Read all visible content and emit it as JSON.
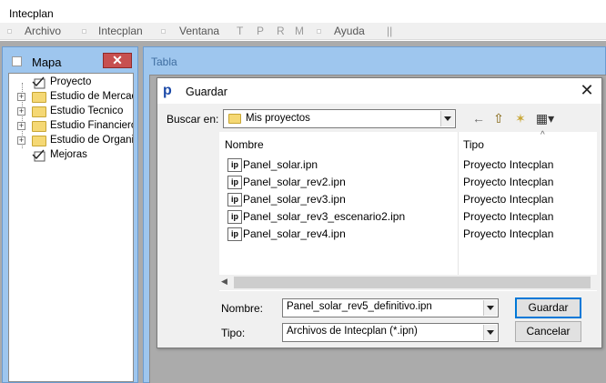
{
  "app": {
    "title": "Intecplan"
  },
  "menu": {
    "items": [
      "Archivo",
      "Intecplan",
      "Ventana",
      "T",
      "P",
      "R",
      "M",
      "Ayuda",
      "||"
    ]
  },
  "mapa": {
    "title": "Mapa",
    "close_glyph": "✕",
    "tree": [
      {
        "label": "Proyecto",
        "kind": "doc",
        "expandable": false
      },
      {
        "label": "Estudio de Mercado",
        "kind": "folder",
        "expandable": true
      },
      {
        "label": "Estudio Tecnico",
        "kind": "folder",
        "expandable": true
      },
      {
        "label": "Estudio Financiero",
        "kind": "folder",
        "expandable": true
      },
      {
        "label": "Estudio de Organizacion",
        "kind": "folder",
        "expandable": true
      },
      {
        "label": "Mejoras",
        "kind": "doc",
        "expandable": false
      }
    ]
  },
  "tabla": {
    "title": "Tabla"
  },
  "dialog": {
    "title": "Guardar",
    "icon_letter": "p",
    "close_glyph": "✕",
    "lookin_label": "Buscar en:",
    "lookin_value": "Mis proyectos",
    "toolbar": {
      "back": "←",
      "up": "⇧",
      "new_folder": "✶",
      "view": "▦▾"
    },
    "columns": {
      "name": "Nombre",
      "type": "Tipo"
    },
    "files": [
      {
        "name": "Panel_solar.ipn",
        "type": "Proyecto Intecplan"
      },
      {
        "name": "Panel_solar_rev2.ipn",
        "type": "Proyecto Intecplan"
      },
      {
        "name": "Panel_solar_rev3.ipn",
        "type": "Proyecto Intecplan"
      },
      {
        "name": "Panel_solar_rev3_escenario2.ipn",
        "type": "Proyecto Intecplan"
      },
      {
        "name": "Panel_solar_rev4.ipn",
        "type": "Proyecto Intecplan"
      }
    ],
    "file_icon_text": "ip",
    "filename_label": "Nombre:",
    "filename_value": "Panel_solar_rev5_definitivo.ipn",
    "filetype_label": "Tipo:",
    "filetype_value": "Archivos de Intecplan (*.ipn)",
    "save_button": "Guardar",
    "cancel_button": "Cancelar"
  }
}
